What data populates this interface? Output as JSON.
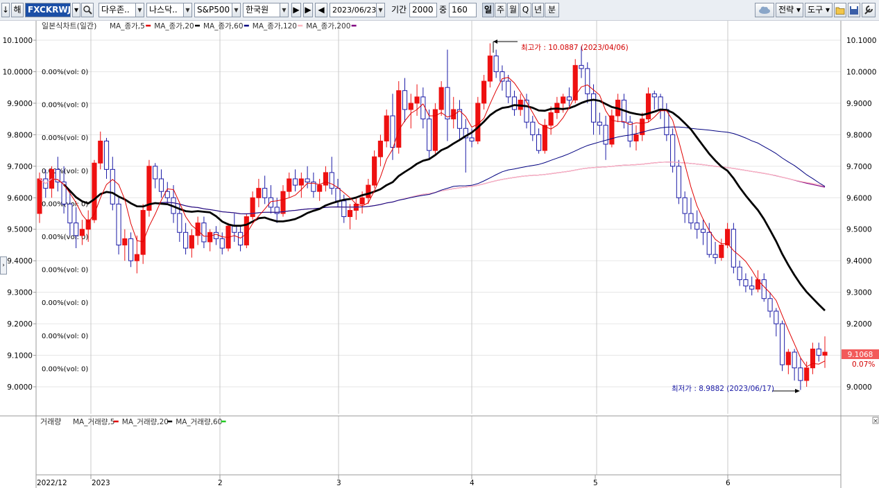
{
  "toolbar": {
    "arrow_label": "↓",
    "year_label": "해",
    "code": "FXCKRWJS",
    "search_icon": "search-icon",
    "index1": "다우존..",
    "index2": "나스닥..",
    "index3": "S&P500",
    "currency": "한국원",
    "date": "2023/06/23",
    "period_label": "기간",
    "period_value": "2000",
    "mid_label": "중",
    "mid_value": "160",
    "intervals": [
      "일",
      "주",
      "월",
      "Q",
      "년",
      "분"
    ],
    "active_interval": "일",
    "right_buttons": [
      "전략",
      "도구"
    ],
    "right_icons": [
      "cloud-icon",
      "folder-icon",
      "save-icon",
      "wrench-icon"
    ]
  },
  "price_panel": {
    "title": "일본식차트(일간)",
    "legend": [
      {
        "label": "MA_종가,5",
        "color": "#e00000"
      },
      {
        "label": "MA_종가,20",
        "color": "#000000"
      },
      {
        "label": "MA_종가,60",
        "color": "#000080"
      },
      {
        "label": "MA_종가,120",
        "color": "#ffb6c1"
      },
      {
        "label": "MA_종가,200",
        "color": "#800080"
      }
    ],
    "y_ticks": [
      "10.1000",
      "10.0000",
      "9.9000",
      "9.8000",
      "9.7000",
      "9.6000",
      "9.5000",
      "9.4000",
      "9.3000",
      "9.2000",
      "9.1000",
      "9.0000"
    ],
    "vol_labels": [
      "0.00%(vol: 0)",
      "0.00%(vol: 0)",
      "0.00%(vol: 0)",
      "0.00%(vol: 0)",
      "0.00%(vol: 0)",
      "0.00%(vol: 0)",
      "0.00%(vol: 0)",
      "0.00%(vol: 0)",
      "0.00%(vol: 0)",
      "0.00%(vol: 0)"
    ],
    "high_annotation": "최고가 : 10.0887 (2023/04/06)",
    "low_annotation": "최저가 : 8.9882 (2023/06/17)",
    "last_price": "9.1068",
    "last_change": "0.07%",
    "up_color": "#ee1111",
    "down_color": "#1a1aa6"
  },
  "volume_panel": {
    "title": "거래량",
    "legend": [
      {
        "label": "MA_거래량,5",
        "color": "#e00000"
      },
      {
        "label": "MA_거래량,20",
        "color": "#000000"
      },
      {
        "label": "MA_거래량,60",
        "color": "#22cc22"
      }
    ]
  },
  "x_axis": {
    "labels": [
      "2022/12",
      "2023",
      "2",
      "3",
      "4",
      "5",
      "6"
    ]
  },
  "chart_data": {
    "type": "candlestick",
    "title": "일본식차트(일간)",
    "ylim": [
      8.96,
      10.12
    ],
    "x_range": [
      "2022-11-28",
      "2023-06-23"
    ],
    "grid": true,
    "high": {
      "value": 10.0887,
      "date": "2023/04/06"
    },
    "low": {
      "value": 8.9882,
      "date": "2023/06/17"
    },
    "last": 9.1068,
    "candles_ohlc": [
      [
        9.55,
        9.68,
        9.52,
        9.66
      ],
      [
        9.66,
        9.69,
        9.6,
        9.63
      ],
      [
        9.63,
        9.7,
        9.6,
        9.69
      ],
      [
        9.69,
        9.73,
        9.62,
        9.65
      ],
      [
        9.65,
        9.7,
        9.55,
        9.58
      ],
      [
        9.58,
        9.62,
        9.48,
        9.52
      ],
      [
        9.52,
        9.57,
        9.44,
        9.48
      ],
      [
        9.48,
        9.53,
        9.45,
        9.5
      ],
      [
        9.5,
        9.56,
        9.46,
        9.53
      ],
      [
        9.53,
        9.72,
        9.52,
        9.71
      ],
      [
        9.71,
        9.81,
        9.69,
        9.78
      ],
      [
        9.78,
        9.79,
        9.66,
        9.69
      ],
      [
        9.69,
        9.73,
        9.56,
        9.58
      ],
      [
        9.58,
        9.6,
        9.42,
        9.45
      ],
      [
        9.45,
        9.5,
        9.4,
        9.47
      ],
      [
        9.47,
        9.49,
        9.38,
        9.4
      ],
      [
        9.4,
        9.48,
        9.36,
        9.42
      ],
      [
        9.42,
        9.58,
        9.39,
        9.56
      ],
      [
        9.56,
        9.72,
        9.54,
        9.7
      ],
      [
        9.7,
        9.71,
        9.63,
        9.66
      ],
      [
        9.66,
        9.69,
        9.6,
        9.62
      ],
      [
        9.62,
        9.65,
        9.58,
        9.6
      ],
      [
        9.6,
        9.64,
        9.52,
        9.55
      ],
      [
        9.55,
        9.58,
        9.46,
        9.49
      ],
      [
        9.49,
        9.52,
        9.42,
        9.44
      ],
      [
        9.44,
        9.5,
        9.41,
        9.48
      ],
      [
        9.48,
        9.54,
        9.45,
        9.52
      ],
      [
        9.52,
        9.54,
        9.44,
        9.46
      ],
      [
        9.46,
        9.5,
        9.43,
        9.49
      ],
      [
        9.49,
        9.51,
        9.45,
        9.47
      ],
      [
        9.47,
        9.49,
        9.42,
        9.44
      ],
      [
        9.44,
        9.52,
        9.43,
        9.51
      ],
      [
        9.51,
        9.55,
        9.46,
        9.49
      ],
      [
        9.49,
        9.51,
        9.43,
        9.45
      ],
      [
        9.45,
        9.55,
        9.44,
        9.54
      ],
      [
        9.54,
        9.62,
        9.53,
        9.6
      ],
      [
        9.6,
        9.66,
        9.57,
        9.63
      ],
      [
        9.63,
        9.67,
        9.58,
        9.6
      ],
      [
        9.6,
        9.64,
        9.55,
        9.57
      ],
      [
        9.57,
        9.6,
        9.52,
        9.55
      ],
      [
        9.55,
        9.64,
        9.54,
        9.62
      ],
      [
        9.62,
        9.68,
        9.6,
        9.66
      ],
      [
        9.66,
        9.69,
        9.62,
        9.64
      ],
      [
        9.64,
        9.68,
        9.6,
        9.66
      ],
      [
        9.66,
        9.7,
        9.63,
        9.65
      ],
      [
        9.65,
        9.68,
        9.6,
        9.62
      ],
      [
        9.62,
        9.66,
        9.59,
        9.64
      ],
      [
        9.64,
        9.7,
        9.62,
        9.68
      ],
      [
        9.68,
        9.73,
        9.61,
        9.63
      ],
      [
        9.63,
        9.66,
        9.57,
        9.59
      ],
      [
        9.59,
        9.61,
        9.52,
        9.54
      ],
      [
        9.54,
        9.58,
        9.5,
        9.56
      ],
      [
        9.56,
        9.6,
        9.53,
        9.58
      ],
      [
        9.58,
        9.62,
        9.55,
        9.6
      ],
      [
        9.6,
        9.66,
        9.58,
        9.64
      ],
      [
        9.64,
        9.75,
        9.63,
        9.73
      ],
      [
        9.73,
        9.8,
        9.7,
        9.78
      ],
      [
        9.78,
        9.88,
        9.76,
        9.86
      ],
      [
        9.86,
        9.93,
        9.72,
        9.76
      ],
      [
        9.76,
        9.97,
        9.74,
        9.94
      ],
      [
        9.94,
        9.98,
        9.84,
        9.88
      ],
      [
        9.88,
        9.93,
        9.82,
        9.9
      ],
      [
        9.9,
        9.96,
        9.86,
        9.92
      ],
      [
        9.92,
        9.95,
        9.82,
        9.85
      ],
      [
        9.85,
        9.88,
        9.72,
        9.75
      ],
      [
        9.75,
        9.9,
        9.74,
        9.88
      ],
      [
        9.88,
        9.97,
        9.86,
        9.95
      ],
      [
        9.95,
        10.07,
        9.78,
        9.85
      ],
      [
        9.85,
        9.92,
        9.82,
        9.88
      ],
      [
        9.88,
        9.91,
        9.78,
        9.82
      ],
      [
        9.82,
        9.85,
        9.68,
        9.79
      ],
      [
        9.79,
        9.82,
        9.76,
        9.78
      ],
      [
        9.78,
        9.92,
        9.77,
        9.9
      ],
      [
        9.9,
        9.99,
        9.88,
        9.97
      ],
      [
        9.97,
        10.09,
        9.95,
        10.05
      ],
      [
        10.05,
        10.07,
        9.98,
        10.0
      ],
      [
        10.0,
        10.02,
        9.94,
        9.97
      ],
      [
        9.97,
        9.99,
        9.9,
        9.92
      ],
      [
        9.92,
        9.94,
        9.86,
        9.88
      ],
      [
        9.88,
        9.93,
        9.86,
        9.91
      ],
      [
        9.91,
        9.93,
        9.82,
        9.84
      ],
      [
        9.84,
        9.86,
        9.78,
        9.8
      ],
      [
        9.8,
        9.82,
        9.74,
        9.75
      ],
      [
        9.75,
        9.85,
        9.74,
        9.83
      ],
      [
        9.83,
        9.89,
        9.8,
        9.87
      ],
      [
        9.87,
        9.92,
        9.85,
        9.9
      ],
      [
        9.9,
        9.93,
        9.87,
        9.92
      ],
      [
        9.92,
        9.95,
        9.89,
        9.91
      ],
      [
        9.91,
        10.04,
        9.9,
        10.02
      ],
      [
        10.02,
        10.08,
        9.98,
        10.01
      ],
      [
        10.01,
        10.03,
        9.9,
        9.93
      ],
      [
        9.93,
        9.96,
        9.8,
        9.84
      ],
      [
        9.84,
        9.87,
        9.8,
        9.83
      ],
      [
        9.83,
        9.86,
        9.72,
        9.77
      ],
      [
        9.77,
        9.88,
        9.76,
        9.86
      ],
      [
        9.86,
        9.93,
        9.84,
        9.91
      ],
      [
        9.91,
        9.93,
        9.82,
        9.84
      ],
      [
        9.84,
        9.86,
        9.76,
        9.78
      ],
      [
        9.78,
        9.83,
        9.75,
        9.8
      ],
      [
        9.8,
        9.87,
        9.78,
        9.85
      ],
      [
        9.85,
        9.95,
        9.84,
        9.93
      ],
      [
        9.93,
        9.94,
        9.88,
        9.92
      ],
      [
        9.92,
        9.93,
        9.85,
        9.88
      ],
      [
        9.88,
        9.9,
        9.78,
        9.8
      ],
      [
        9.8,
        9.82,
        9.68,
        9.7
      ],
      [
        9.7,
        9.72,
        9.58,
        9.6
      ],
      [
        9.6,
        9.62,
        9.52,
        9.55
      ],
      [
        9.55,
        9.6,
        9.5,
        9.52
      ],
      [
        9.52,
        9.56,
        9.47,
        9.5
      ],
      [
        9.5,
        9.53,
        9.45,
        9.49
      ],
      [
        9.49,
        9.52,
        9.41,
        9.42
      ],
      [
        9.42,
        9.46,
        9.39,
        9.41
      ],
      [
        9.41,
        9.47,
        9.4,
        9.45
      ],
      [
        9.45,
        9.52,
        9.44,
        9.5
      ],
      [
        9.5,
        9.52,
        9.36,
        9.38
      ],
      [
        9.38,
        9.4,
        9.32,
        9.34
      ],
      [
        9.34,
        9.36,
        9.3,
        9.32
      ],
      [
        9.32,
        9.35,
        9.29,
        9.31
      ],
      [
        9.31,
        9.37,
        9.3,
        9.34
      ],
      [
        9.34,
        9.36,
        9.27,
        9.28
      ],
      [
        9.28,
        9.3,
        9.22,
        9.24
      ],
      [
        9.24,
        9.25,
        9.16,
        9.2
      ],
      [
        9.2,
        9.21,
        9.05,
        9.07
      ],
      [
        9.07,
        9.12,
        9.04,
        9.11
      ],
      [
        9.11,
        9.12,
        9.02,
        9.06
      ],
      [
        9.06,
        9.09,
        8.99,
        9.02
      ],
      [
        9.02,
        9.08,
        9.0,
        9.06
      ],
      [
        9.06,
        9.14,
        9.04,
        9.12
      ],
      [
        9.12,
        9.14,
        9.08,
        9.1
      ],
      [
        9.1,
        9.16,
        9.06,
        9.11
      ]
    ]
  }
}
